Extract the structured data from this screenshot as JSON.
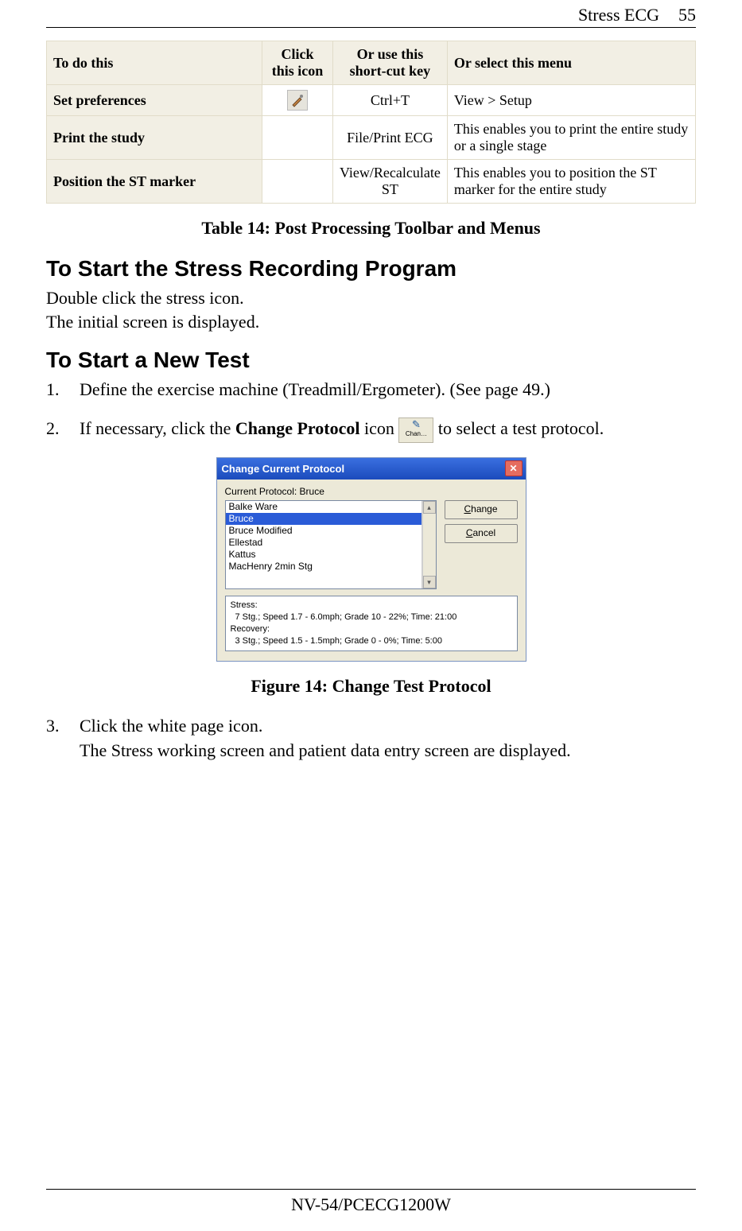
{
  "header": {
    "section": "Stress ECG",
    "page": "55"
  },
  "table": {
    "header": {
      "c1": "To do this",
      "c2": "Click this icon",
      "c3": "Or use this short-cut key",
      "c4": "Or select this menu"
    },
    "rows": [
      {
        "label": "Set preferences",
        "icon": "preferences-icon",
        "shortcut": "Ctrl+T",
        "menu": "View > Setup"
      },
      {
        "label": "Print the study",
        "icon": "",
        "shortcut": "File/Print ECG",
        "menu": "This enables you to print the entire study or a single stage"
      },
      {
        "label": "Position the ST marker",
        "icon": "",
        "shortcut": "View/Recalculate ST",
        "menu": "This enables you to position the ST marker for the entire study"
      }
    ]
  },
  "caption_table": "Table 14: Post Processing Toolbar and Menus",
  "h2_start_program": "To Start the Stress Recording Program",
  "body_start_program": "Double click the stress icon.\nThe initial screen is displayed.",
  "h2_new_test": "To Start a New Test",
  "steps": {
    "s1": "Define the exercise machine (Treadmill/Ergometer). (See page 49.)",
    "s2_pre": "If necessary, click the ",
    "s2_bold": "Change Protocol",
    "s2_mid": " icon ",
    "s2_post": " to select a test protocol.",
    "s2_icon_label": "Chan…",
    "s3": "Click the white page icon.\nThe Stress working screen and patient data entry screen are displayed."
  },
  "dialog": {
    "title": "Change Current Protocol",
    "close_glyph": "✕",
    "current_label": "Current Protocol: Bruce",
    "list": [
      "Balke Ware",
      "Bruce",
      "Bruce Modified",
      "Ellestad",
      "Kattus",
      "MacHenry 2min Stg"
    ],
    "selected_index": 1,
    "scroll_up": "▴",
    "scroll_down": "▾",
    "btn_change_leading": "C",
    "btn_change_rest": "hange",
    "btn_cancel_leading": "C",
    "btn_cancel_rest": "ancel",
    "info_title": "Stress:",
    "info_line1": "7 Stg.; Speed 1.7 - 6.0mph; Grade 10 - 22%; Time: 21:00",
    "info_rec_title": "Recovery:",
    "info_line2": "3 Stg.; Speed 1.5 - 1.5mph; Grade 0 - 0%; Time: 5:00"
  },
  "caption_figure": "Figure 14: Change Test Protocol",
  "footer": "NV-54/PCECG1200W"
}
